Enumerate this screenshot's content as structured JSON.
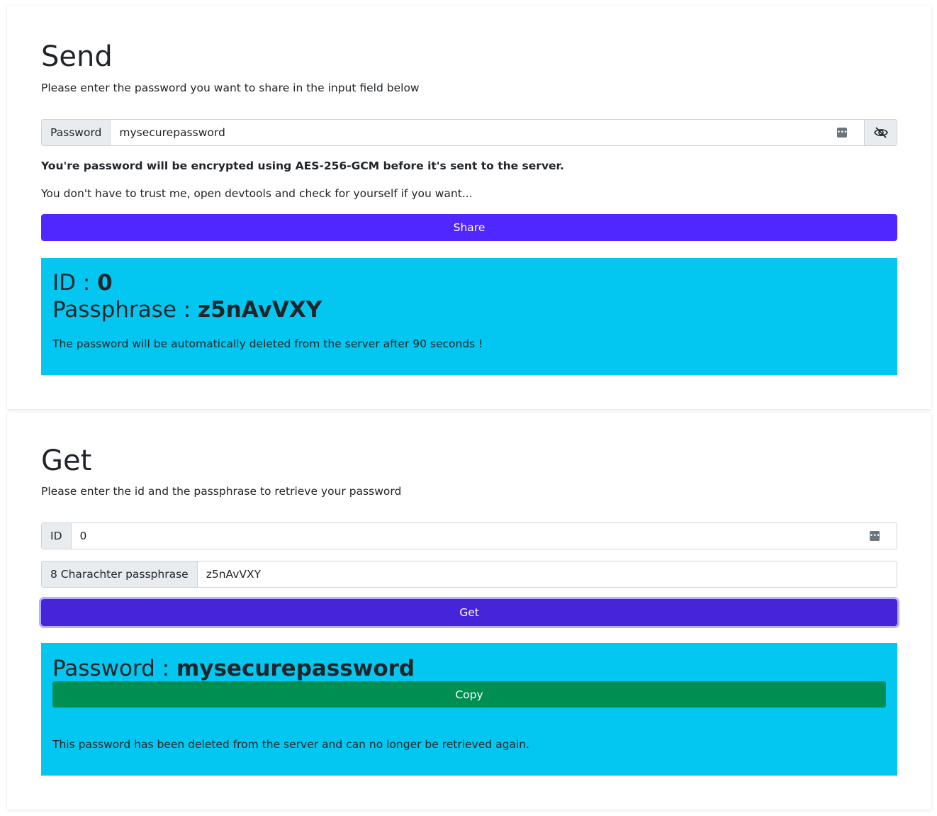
{
  "send": {
    "title": "Send",
    "description": "Please enter the password you want to share in the input field below",
    "password_label": "Password",
    "password_value": "mysecurepassword",
    "encryption_note": "You're password will be encrypted using AES-256-GCM before it's sent to the server.",
    "trust_note": "You don't have to trust me, open devtools and check for yourself if you want...",
    "share_label": "Share",
    "result": {
      "id_label": "ID : ",
      "id_value": "0",
      "passphrase_label": "Passphrase : ",
      "passphrase_value": "z5nAvVXY",
      "expiry_note": "The password will be automatically deleted from the server after 90 seconds !"
    }
  },
  "get": {
    "title": "Get",
    "description": "Please enter the id and the passphrase to retrieve your password",
    "id_label": "ID",
    "id_value": "0",
    "passphrase_label": "8 Charachter passphrase",
    "passphrase_value": "z5nAvVXY",
    "get_label": "Get",
    "result": {
      "password_label": "Password : ",
      "password_value": "mysecurepassword",
      "copy_label": "Copy",
      "deleted_note": "This password has been deleted from the server and can no longer be retrieved again."
    }
  },
  "colors": {
    "primary": "#5028ff",
    "info": "#03c7f0",
    "success": "#008f53"
  },
  "icons": {
    "password_manager": "key-icon",
    "toggle_visibility": "eye-slash-icon"
  }
}
